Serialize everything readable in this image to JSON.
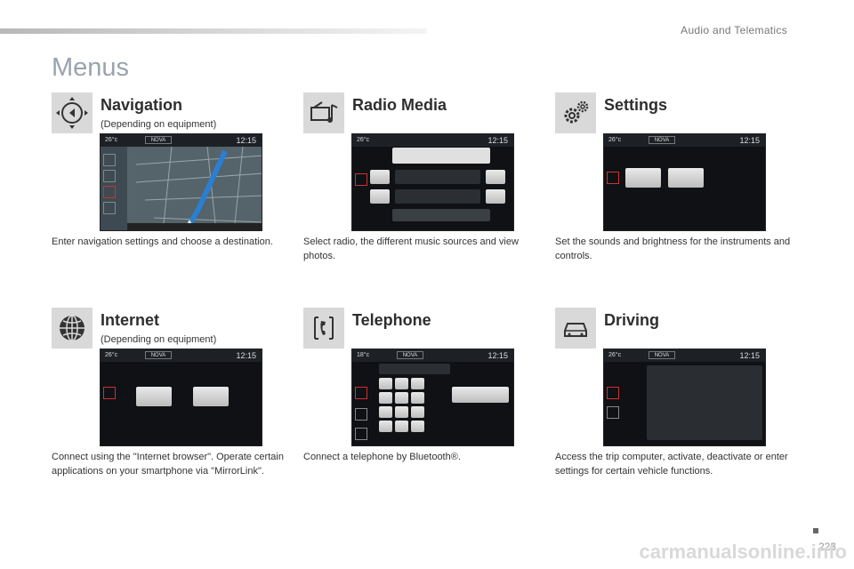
{
  "header": {
    "section_title": "Audio and Telematics",
    "page_heading": "Menus"
  },
  "blocks": {
    "navigation": {
      "title": "Navigation",
      "note": "(Depending on equipment)",
      "desc": "Enter navigation settings and choose a destination.",
      "icon": "navigation-dpad-icon",
      "screen": {
        "temp": "26°c",
        "station": "NOVA",
        "time": "12:15"
      }
    },
    "radio": {
      "title": "Radio Media",
      "desc": "Select radio, the different music sources and view photos.",
      "icon": "radio-media-icon",
      "screen": {
        "temp": "26°c",
        "station": "NOVA",
        "time": "12:15"
      }
    },
    "settings": {
      "title": "Settings",
      "desc": "Set the sounds and brightness for the instruments and controls.",
      "icon": "settings-gears-icon",
      "screen": {
        "temp": "26°c",
        "station": "NOVA",
        "time": "12:15"
      }
    },
    "internet": {
      "title": "Internet",
      "note": "(Depending on equipment)",
      "desc": "Connect using the \"Internet browser\". Operate certain applications on your smartphone via \"MirrorLink\".",
      "icon": "internet-globe-icon",
      "screen": {
        "temp": "26°c",
        "station": "NOVA",
        "time": "12:15"
      }
    },
    "telephone": {
      "title": "Telephone",
      "desc": "Connect a telephone by Bluetooth®.",
      "icon": "telephone-icon",
      "screen": {
        "temp": "18°c",
        "station": "NOVA",
        "time": "12:15"
      }
    },
    "driving": {
      "title": "Driving",
      "desc": "Access the trip computer, activate, deactivate or enter settings for certain vehicle functions.",
      "icon": "car-icon",
      "screen": {
        "temp": "26°c",
        "station": "NOVA",
        "time": "12:15"
      }
    }
  },
  "footer": {
    "page_number": "223",
    "watermark": "carmanualsonline.info"
  }
}
